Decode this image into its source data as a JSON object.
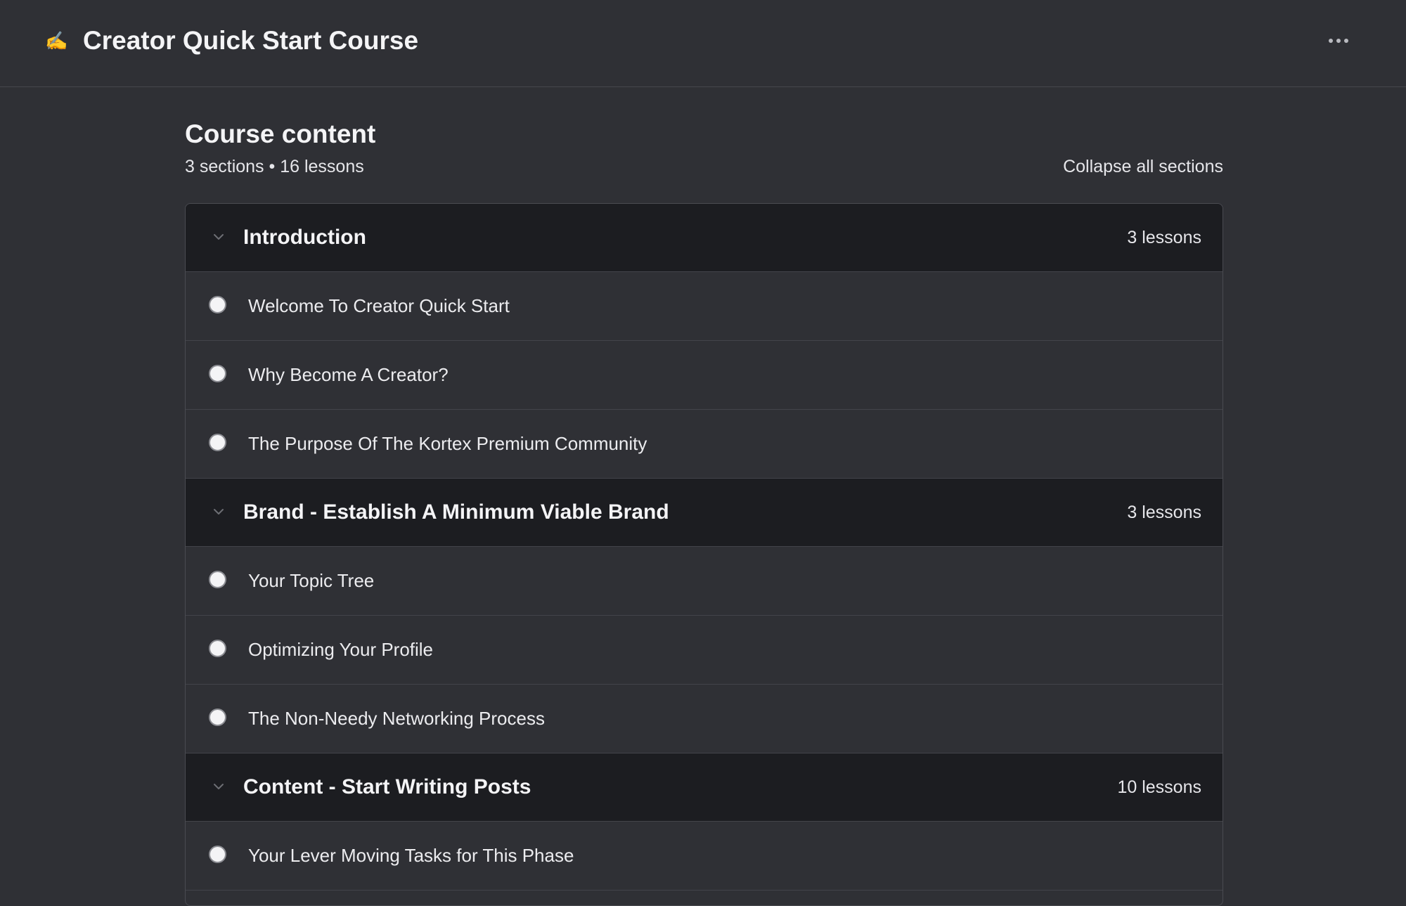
{
  "header": {
    "icon": "writing-hand-emoji",
    "icon_glyph": "✍️",
    "title": "Creator Quick Start Course",
    "more_icon": "more-horizontal-icon"
  },
  "course": {
    "heading": "Course content",
    "summary": "3 sections • 16 lessons",
    "collapse_label": "Collapse all sections"
  },
  "sections": [
    {
      "title": "Introduction",
      "count": "3 lessons",
      "lessons": [
        "Welcome To Creator Quick Start",
        "Why Become A Creator?",
        "The Purpose Of The Kortex Premium Community"
      ]
    },
    {
      "title": "Brand - Establish A Minimum Viable Brand",
      "count": "3 lessons",
      "lessons": [
        "Your Topic Tree",
        "Optimizing Your Profile",
        "The Non-Needy Networking Process"
      ]
    },
    {
      "title": "Content - Start Writing Posts",
      "count": "10 lessons",
      "lessons": [
        "Your Lever Moving Tasks for This Phase"
      ]
    }
  ],
  "colors": {
    "background": "#2f3035",
    "section_header_bg": "#1c1d21",
    "text": "#f1f1f3",
    "divider": "#43444a"
  }
}
